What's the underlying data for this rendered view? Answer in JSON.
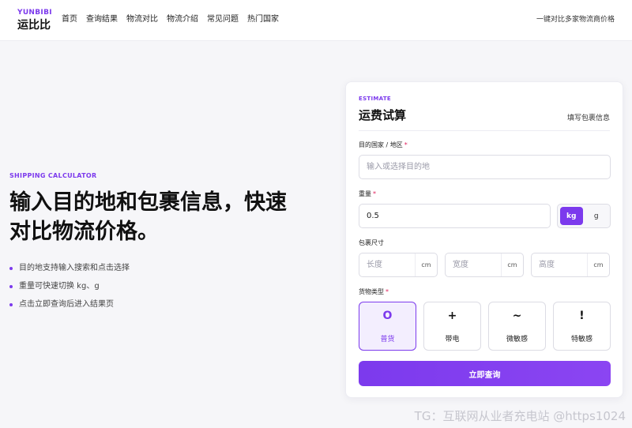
{
  "brand": {
    "en": "YUNBIBI",
    "cn": "运比比"
  },
  "nav": [
    "首页",
    "查询结果",
    "物流对比",
    "物流介绍",
    "常见问题",
    "热门国家"
  ],
  "header_right": "一键对比多家物流商价格",
  "hero": {
    "eyebrow": "SHIPPING CALCULATOR",
    "title": "输入目的地和包裹信息，快速对比物流价格。",
    "bullets": [
      "目的地支持输入搜索和点击选择",
      "重量可快速切换 kg、g",
      "点击立即查询后进入结果页"
    ]
  },
  "card": {
    "eyebrow": "ESTIMATE",
    "title": "运费试算",
    "hint": "填写包裹信息",
    "destination": {
      "label": "目的国家 / 地区",
      "required_mark": "*",
      "placeholder": "输入或选择目的地",
      "value": ""
    },
    "weight": {
      "label": "重量",
      "required_mark": "*",
      "value": "0.5",
      "units": [
        "kg",
        "g"
      ],
      "selected_unit": "kg"
    },
    "dimensions": {
      "label": "包裹尺寸",
      "fields": [
        {
          "placeholder": "长度",
          "unit": "cm"
        },
        {
          "placeholder": "宽度",
          "unit": "cm"
        },
        {
          "placeholder": "高度",
          "unit": "cm"
        }
      ]
    },
    "cargo_type": {
      "label": "货物类型",
      "required_mark": "*",
      "options": [
        {
          "icon": "O",
          "label": "普货",
          "selected": true
        },
        {
          "icon": "+",
          "label": "带电",
          "selected": false
        },
        {
          "icon": "~",
          "label": "微敏感",
          "selected": false
        },
        {
          "icon": "!",
          "label": "特敏感",
          "selected": false
        }
      ]
    },
    "submit_label": "立即查询"
  },
  "colors": {
    "accent": "#7c3aed",
    "background": "#f6f6f9",
    "required": "#e0245e"
  },
  "watermark": "TG：互联网从业者充电站 @https1024"
}
